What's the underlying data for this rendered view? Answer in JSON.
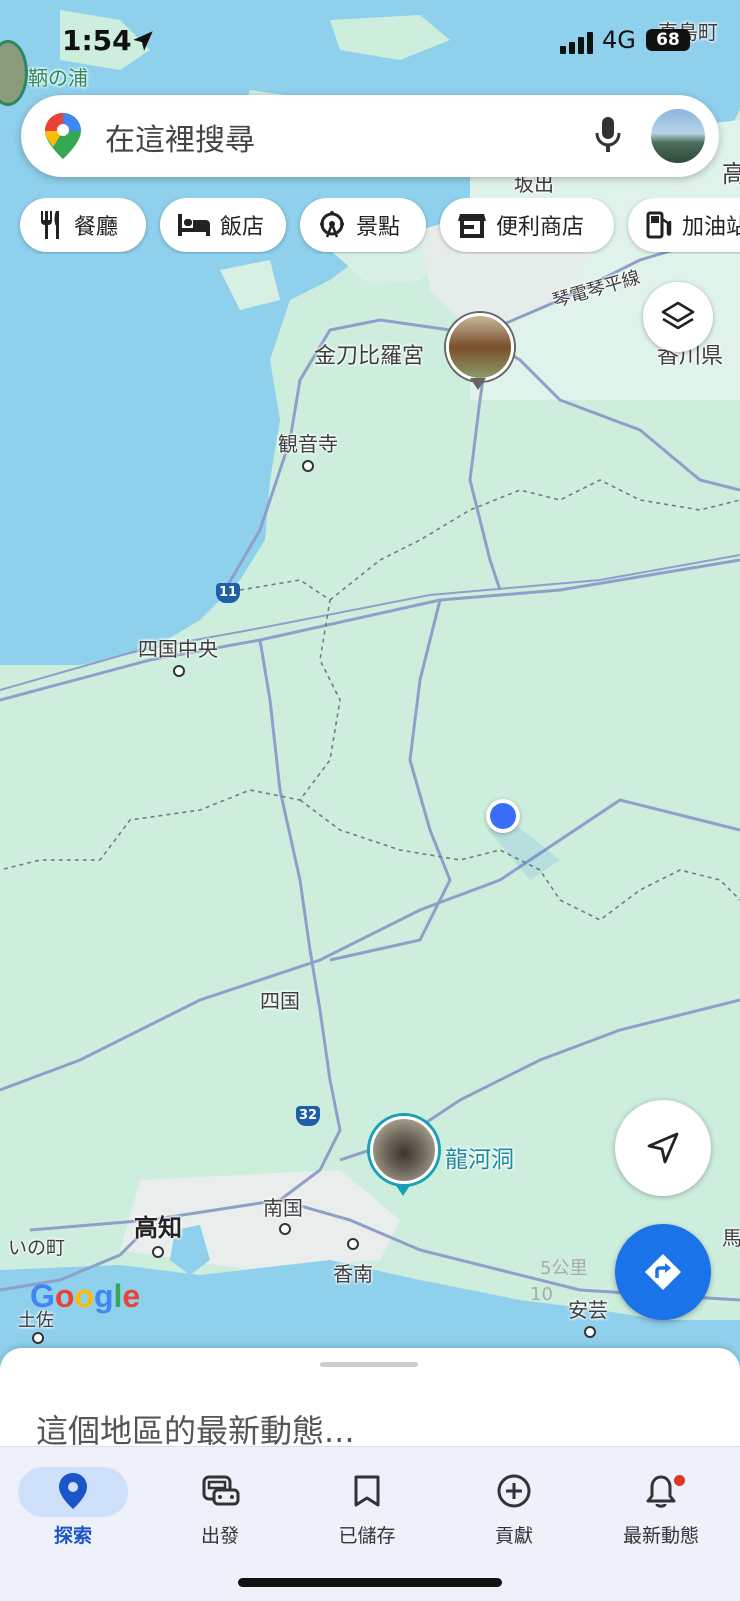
{
  "status_bar": {
    "time": "1:54",
    "network": "4G",
    "battery": "68"
  },
  "search": {
    "placeholder": "在這裡搜尋"
  },
  "chips": [
    {
      "label": "餐廳",
      "icon": "fork-knife-icon"
    },
    {
      "label": "飯店",
      "icon": "bed-icon"
    },
    {
      "label": "景點",
      "icon": "ferris-wheel-icon"
    },
    {
      "label": "便利商店",
      "icon": "store-icon"
    },
    {
      "label": "加油站",
      "icon": "gas-pump-icon"
    }
  ],
  "map_labels": {
    "tomonoura": "鞆の浦",
    "naoshima": "直島町",
    "sakaide": "坂出",
    "taka": "高",
    "kotohira_line": "琴電琴平線",
    "kotohira": "金刀比羅宮",
    "kagawa": "香川県",
    "kanonji": "観音寺",
    "shikokuchuo": "四国中央",
    "shikoku": "四国",
    "ryugado": "龍河洞",
    "nankoku": "南国",
    "kochi": "高知",
    "ino": "いの町",
    "konan": "香南",
    "aki": "安芸",
    "tosa": "土佐",
    "muro": "馬",
    "route11": "11",
    "route32": "32"
  },
  "scale": {
    "top": "5公里",
    "bottom": "10"
  },
  "google_logo": "Google",
  "sheet": {
    "title": "這個地區的最新動態..."
  },
  "nav": [
    {
      "label": "探索",
      "icon": "location-pin-icon",
      "active": true
    },
    {
      "label": "出發",
      "icon": "car-icon",
      "active": false
    },
    {
      "label": "已儲存",
      "icon": "bookmark-icon",
      "active": false
    },
    {
      "label": "貢獻",
      "icon": "add-circle-icon",
      "active": false
    },
    {
      "label": "最新動態",
      "icon": "bell-icon",
      "active": false
    }
  ],
  "colors": {
    "accent": "#1a73e8",
    "water": "#8fd0ec",
    "land": "#cfeee0",
    "notification": "#e0352b"
  }
}
